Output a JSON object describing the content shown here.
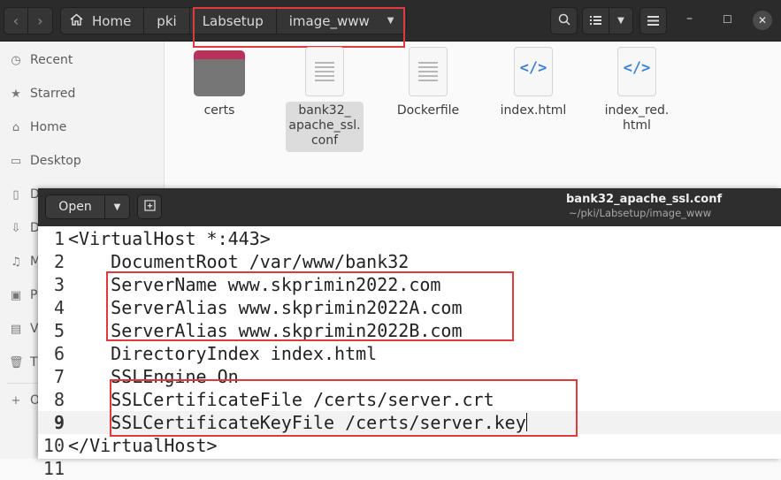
{
  "file_manager": {
    "path": {
      "home": "Home",
      "pki": "pki",
      "labsetup": "Labsetup",
      "current": "image_www"
    },
    "sidebar": [
      {
        "icon": "clock-icon",
        "label": "Recent"
      },
      {
        "icon": "star-icon",
        "label": "Starred"
      },
      {
        "icon": "home-icon",
        "label": "Home"
      },
      {
        "icon": "desktop-icon",
        "label": "Desktop"
      },
      {
        "icon": "document-icon",
        "label": "D"
      },
      {
        "icon": "download-icon",
        "label": "D"
      },
      {
        "icon": "music-icon",
        "label": "M"
      },
      {
        "icon": "picture-icon",
        "label": "P"
      },
      {
        "icon": "video-icon",
        "label": "V"
      },
      {
        "icon": "trash-icon",
        "label": "T"
      },
      {
        "icon": "plus-icon",
        "label": "O"
      }
    ],
    "files": [
      {
        "name": "certs",
        "type": "folder"
      },
      {
        "name": "bank32_\napache_ssl.\nconf",
        "type": "text",
        "selected": true
      },
      {
        "name": "Dockerfile",
        "type": "text"
      },
      {
        "name": "index.html",
        "type": "html"
      },
      {
        "name": "index_red.\nhtml",
        "type": "html"
      }
    ]
  },
  "editor": {
    "open_label": "Open",
    "title": "bank32_apache_ssl.conf",
    "subtitle": "~/pki/Labsetup/image_www",
    "current_line": 9,
    "lines": [
      {
        "n": "1",
        "text": "<VirtualHost *:443>"
      },
      {
        "n": "2",
        "text": "    DocumentRoot /var/www/bank32"
      },
      {
        "n": "3",
        "text": "    ServerName www.skprimin2022.com"
      },
      {
        "n": "4",
        "text": "    ServerAlias www.skprimin2022A.com"
      },
      {
        "n": "5",
        "text": "    ServerAlias www.skprimin2022B.com"
      },
      {
        "n": "6",
        "text": "    DirectoryIndex index.html"
      },
      {
        "n": "7",
        "text": "    SSLEngine On"
      },
      {
        "n": "8",
        "text": "    SSLCertificateFile /certs/server.crt"
      },
      {
        "n": "9",
        "text": "    SSLCertificateKeyFile /certs/server.key"
      },
      {
        "n": "10",
        "text": "</VirtualHost>"
      },
      {
        "n": "11",
        "text": ""
      }
    ]
  },
  "colors": {
    "highlight_box": "#e0393e",
    "folder_tab": "#b8325a",
    "html_icon": "#3d83d6"
  }
}
